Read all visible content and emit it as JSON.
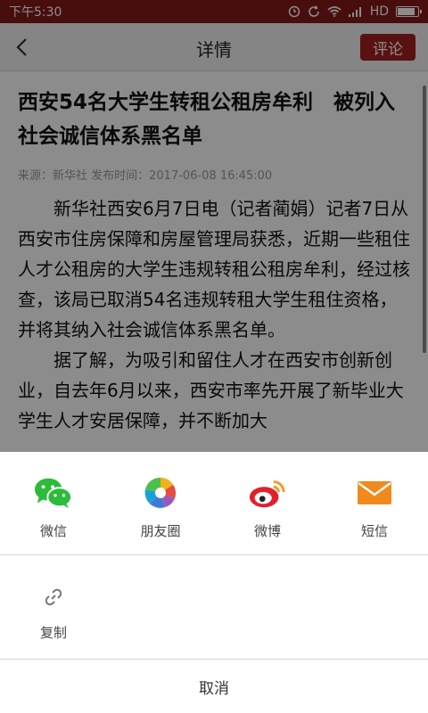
{
  "status": {
    "time": "下午5:30",
    "network": "HD",
    "battery_level": 0.9
  },
  "header": {
    "title": "详情",
    "comment_label": "评论"
  },
  "article": {
    "title": "西安54名大学生转租公租房牟利　被列入社会诚信体系黑名单",
    "meta": "来源：新华社 发布时间：2017-06-08 16:45:00",
    "paragraphs": [
      "新华社西安6月7日电（记者蔺娟）记者7日从西安市住房保障和房屋管理局获悉，近期一些租住人才公租房的大学生违规转租公租房牟利，经过核查，该局已取消54名违规转租大学生租住资格，并将其纳入社会诚信体系黑名单。",
      "据了解，为吸引和留住人才在西安市创新创业，自去年6月以来，西安市率先开展了新毕业大学生人才安居保障，并不断加大"
    ]
  },
  "share": {
    "items": [
      {
        "label": "微信",
        "icon": "wechat-icon"
      },
      {
        "label": "朋友圈",
        "icon": "moments-icon"
      },
      {
        "label": "微博",
        "icon": "weibo-icon"
      },
      {
        "label": "短信",
        "icon": "sms-icon"
      }
    ],
    "copy_label": "复制",
    "cancel_label": "取消"
  },
  "colors": {
    "statusbar": "#831a1a",
    "accent": "#a52020",
    "wechat": "#2dbb3b",
    "sms": "#f08a1c",
    "weibo": "#e3202a"
  }
}
